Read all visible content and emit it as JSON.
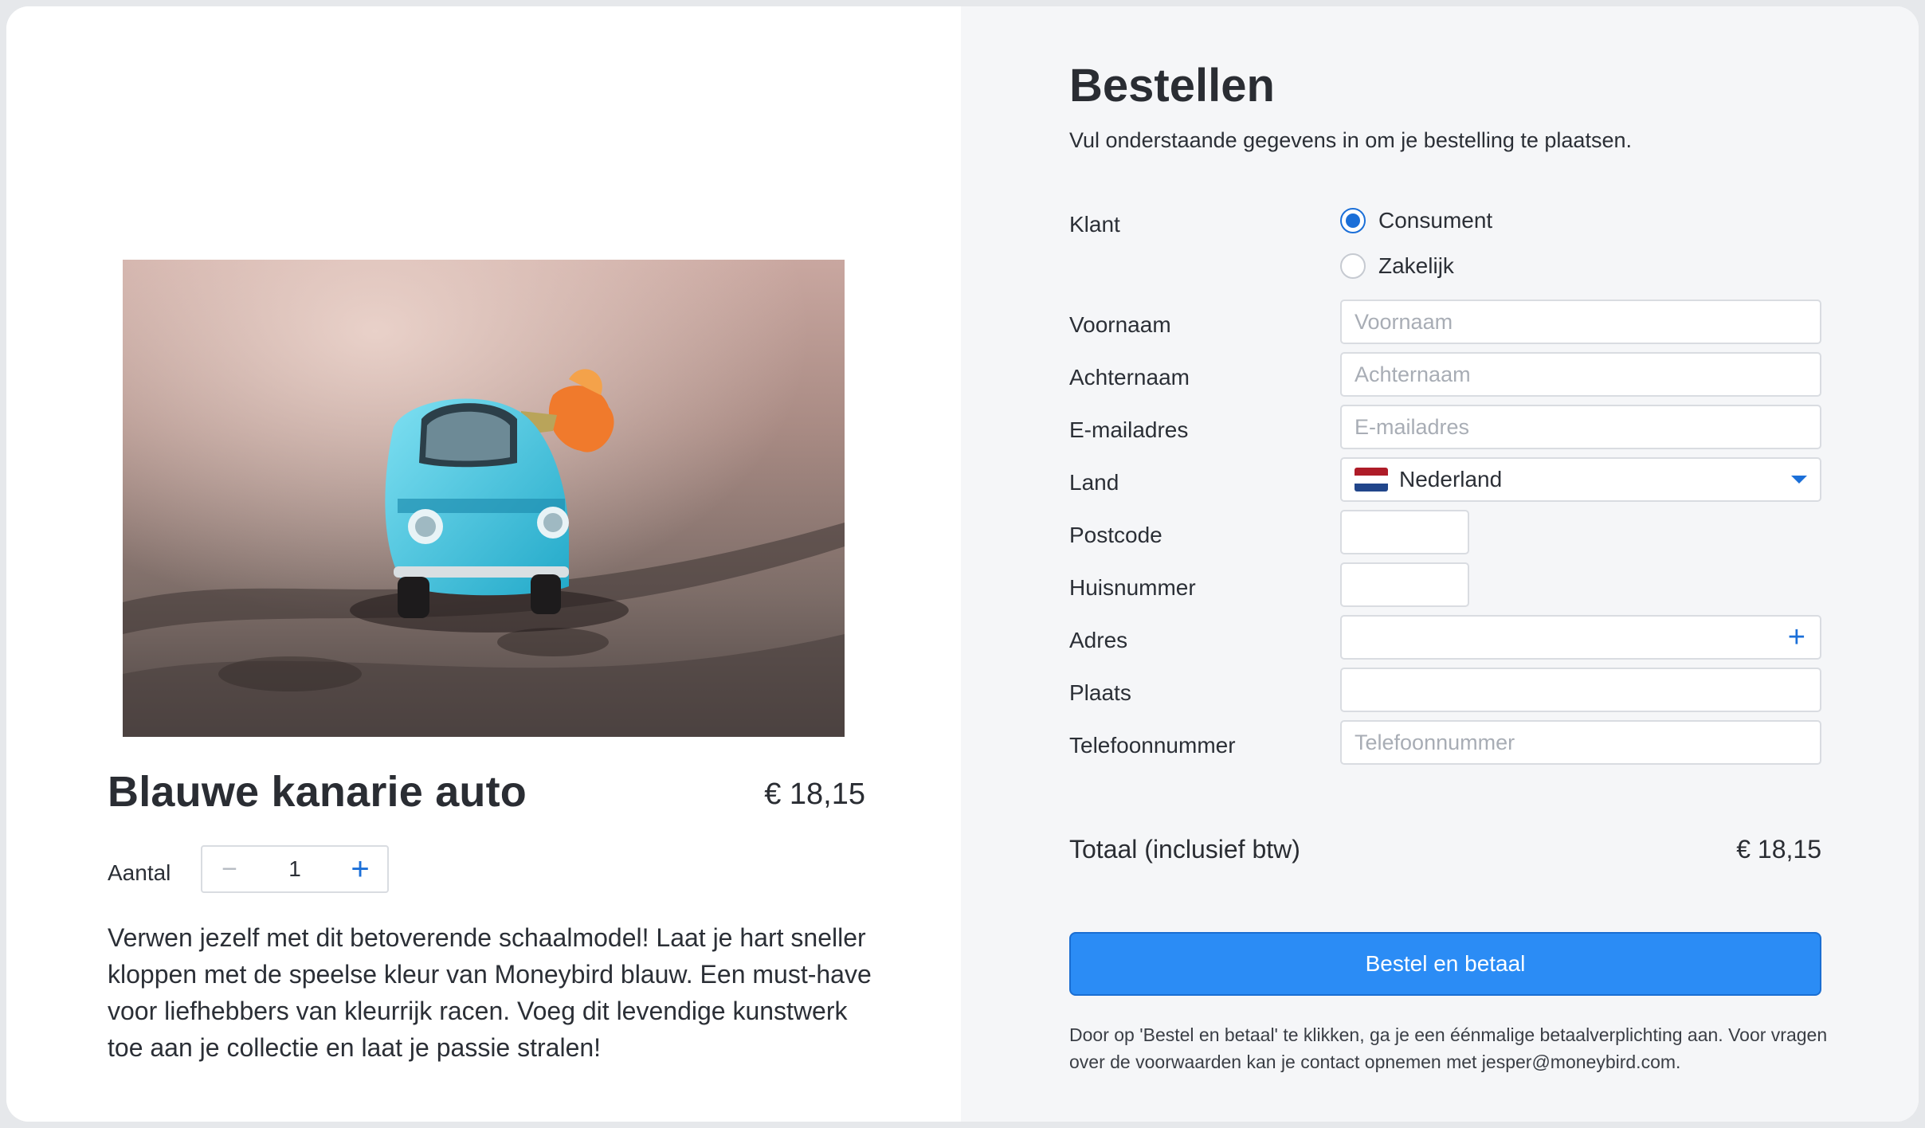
{
  "product": {
    "title": "Blauwe kanarie auto",
    "price": "€ 18,15",
    "quantity_label": "Aantal",
    "quantity_value": "1",
    "minus_symbol": "−",
    "plus_symbol": "+",
    "description": "Verwen jezelf met dit betoverende schaalmodel! Laat je hart sneller kloppen met de speelse kleur van Moneybird blauw. Een must-have voor liefhebbers van kleurrijk racen. Voeg dit levendige kunstwerk toe aan je collectie en laat je passie stralen!"
  },
  "form": {
    "title": "Bestellen",
    "subtitle": "Vul onderstaande gegevens in om je bestelling te plaatsen.",
    "customer_label": "Klant",
    "customer_options": [
      "Consument",
      "Zakelijk"
    ],
    "customer_selected": "Consument",
    "first_name_label": "Voornaam",
    "first_name_placeholder": "Voornaam",
    "last_name_label": "Achternaam",
    "last_name_placeholder": "Achternaam",
    "email_label": "E-mailadres",
    "email_placeholder": "E-mailadres",
    "country_label": "Land",
    "country_value": "Nederland",
    "postcode_label": "Postcode",
    "house_number_label": "Huisnummer",
    "address_label": "Adres",
    "address_plus": "+",
    "city_label": "Plaats",
    "phone_label": "Telefoonnummer",
    "phone_placeholder": "Telefoonnummer"
  },
  "summary": {
    "total_label": "Totaal (inclusief btw)",
    "total_value": "€ 18,15",
    "submit_label": "Bestel en betaal",
    "legal_text": "Door op 'Bestel en betaal' te klikken, ga je een éénmalige betaalverplichting aan. Voor vragen over de voorwaarden kan je contact opnemen met jesper@moneybird.com."
  },
  "icons": {
    "flag": "netherlands-flag-icon",
    "caret": "chevron-down-icon",
    "plus": "plus-icon",
    "minus": "minus-icon"
  },
  "colors": {
    "accent": "#1b6fd8",
    "button": "#2b8cf5",
    "flag_red": "#ae1c28",
    "flag_white": "#ffffff",
    "flag_blue": "#21468b"
  }
}
